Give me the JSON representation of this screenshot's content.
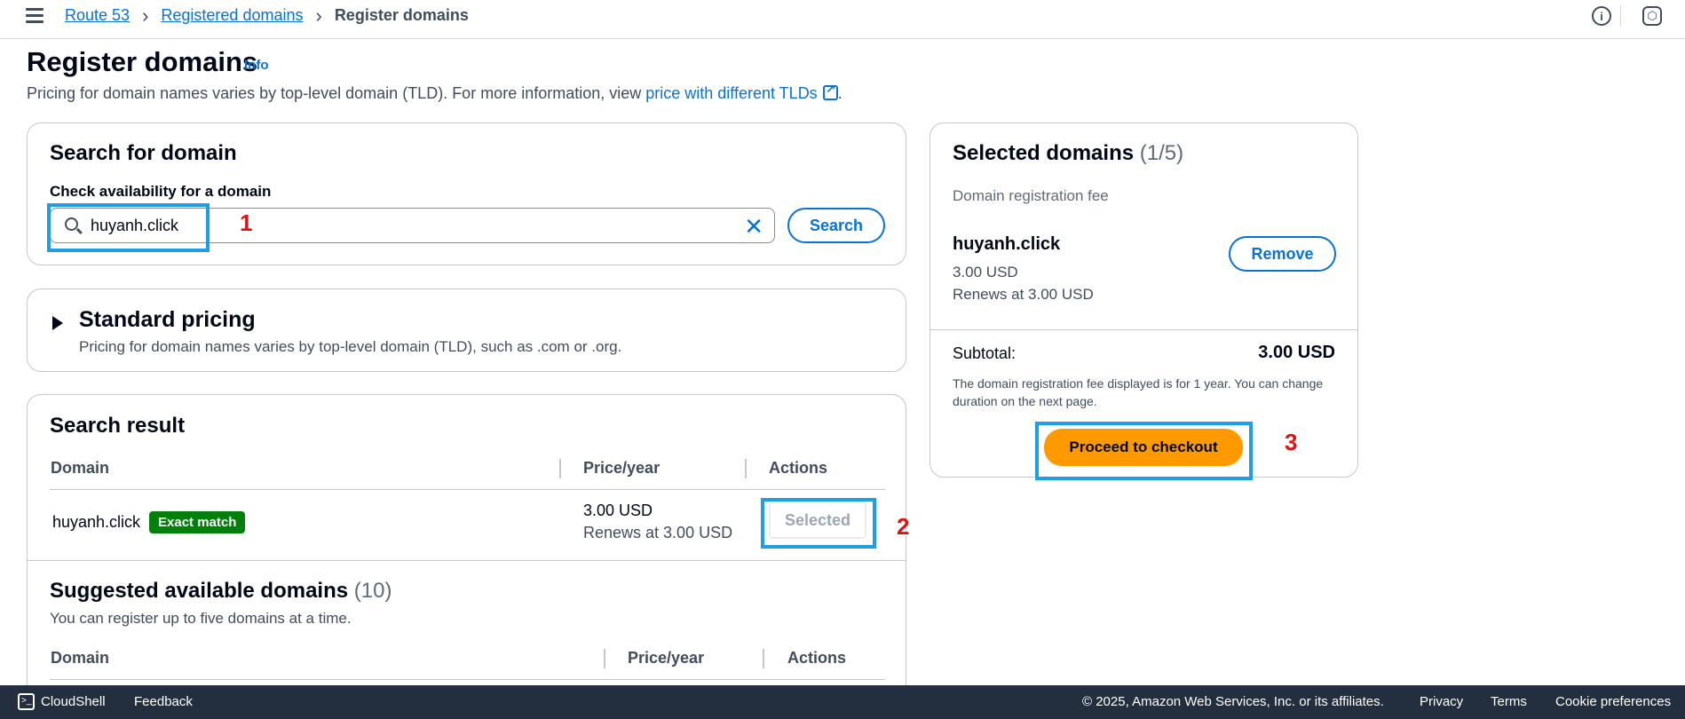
{
  "nav": {
    "breadcrumbs": [
      "Route 53",
      "Registered domains"
    ],
    "current": "Register domains",
    "sep": "›",
    "info_glyph": "i",
    "settings_glyph": "⬡",
    "icons": [
      "menu-icon",
      "info-icon",
      "settings-icon"
    ]
  },
  "header": {
    "title": "Register domains",
    "info": "Info",
    "desc_prefix": "Pricing for domain names varies by top-level domain (TLD). For more information, view ",
    "desc_link": "price with different TLDs",
    "desc_suffix": "."
  },
  "search": {
    "title": "Search for domain",
    "label": "Check availability for a domain",
    "value": "huyanh.click",
    "clear_glyph": "✕",
    "button": "Search"
  },
  "pricing": {
    "title": "Standard pricing",
    "desc": "Pricing for domain names varies by top-level domain (TLD), such as .com or .org."
  },
  "results": {
    "title": "Search result",
    "headers": [
      "Domain",
      "Price/year",
      "Actions"
    ],
    "row": {
      "domain": "huyanh.click",
      "badge": "Exact match",
      "price": "3.00 USD",
      "renews": "Renews at 3.00 USD",
      "action": "Selected"
    }
  },
  "suggested": {
    "title": "Suggested available domains",
    "count": "(10)",
    "desc": "You can register up to five domains at a time.",
    "headers": [
      "Domain",
      "Price/year",
      "Actions"
    ]
  },
  "selected": {
    "title": "Selected domains",
    "count": "(1/5)",
    "fee_label": "Domain registration fee",
    "domain": "huyanh.click",
    "price": "3.00 USD",
    "renews": "Renews at 3.00 USD",
    "remove": "Remove",
    "subtotal_label": "Subtotal:",
    "subtotal_value": "3.00 USD",
    "note": "The domain registration fee displayed is for 1 year. You can change duration on the next page.",
    "checkout": "Proceed to checkout"
  },
  "annotations": [
    "1",
    "2",
    "3"
  ],
  "footer": {
    "cloudshell": "CloudShell",
    "feedback": "Feedback",
    "copyright": "© 2025, Amazon Web Services, Inc. or its affiliates.",
    "privacy": "Privacy",
    "terms": "Terms",
    "cookies": "Cookie preferences",
    "cloudshell_glyph": ">_"
  },
  "colors": {
    "link": "#0972d3",
    "primary_button": "#ff9900",
    "badge": "#037f0c",
    "annotation_box": "#1f9ee6",
    "annotation_number": "#d91515",
    "footer_bg": "#232f3e"
  }
}
